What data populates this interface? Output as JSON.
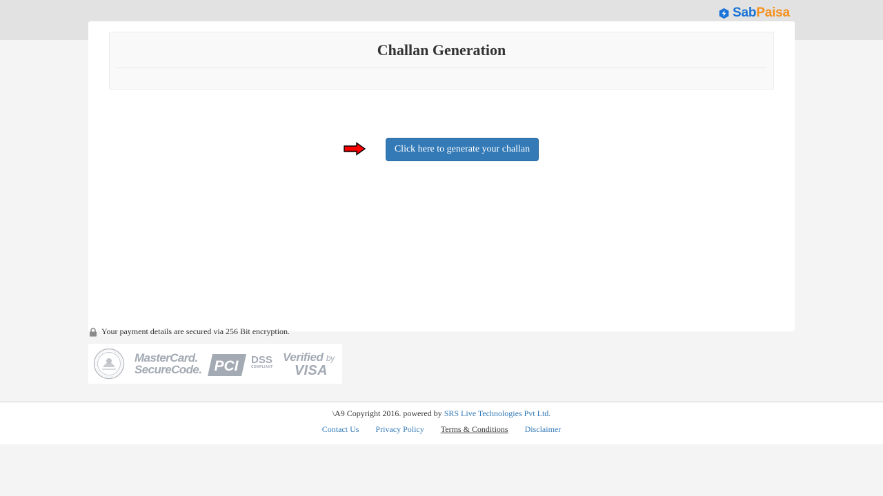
{
  "header": {
    "logo_sab": "Sab",
    "logo_paisa": "Paisa"
  },
  "panel": {
    "title": "Challan Generation"
  },
  "main": {
    "generate_button_label": "Click here to generate your challan"
  },
  "security": {
    "message": "Your payment details are secured via 256 Bit encryption."
  },
  "badges": {
    "mastercard_line1": "MasterCard.",
    "mastercard_line2": "SecureCode.",
    "pci_text": "PCI",
    "dss_text": "DSS",
    "dss_sub": "COMPLIANT",
    "vbv_line1": "Verified",
    "vbv_by": "by",
    "vbv_line2": "VISA"
  },
  "footer": {
    "copyright_prefix": "\\A9 Copyright 2016. powered by ",
    "company_link": "SRS Live Technologies Pvt Ltd.",
    "links": [
      "Contact Us",
      "Privacy Policy",
      "Terms & Conditions",
      "Disclaimer"
    ]
  },
  "colors": {
    "primary_button": "#337ab7",
    "logo_blue": "#1a73d6",
    "logo_orange": "#f6901e",
    "arrow_red": "#ff0000"
  },
  "icons": [
    "sabpaisa-logo-icon",
    "red-arrow-icon",
    "lock-icon",
    "rbi-seal-icon"
  ]
}
